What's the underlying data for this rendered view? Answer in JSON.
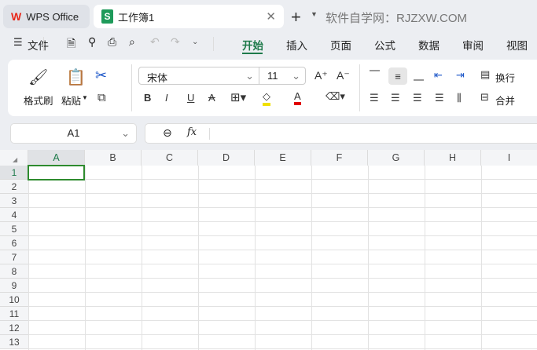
{
  "tabs": {
    "home": "WPS Office",
    "doc": "工作簿1",
    "watermark": "软件自学网：RJZXW.COM"
  },
  "menu": {
    "file": "文件",
    "items": [
      "开始",
      "插入",
      "页面",
      "公式",
      "数据",
      "审阅",
      "视图"
    ],
    "active": 0
  },
  "ribbon": {
    "format_painter": "格式刷",
    "paste": "粘贴",
    "font": "宋体",
    "size": "11",
    "wrap": "换行",
    "merge": "合并"
  },
  "formula_bar": {
    "cell_ref": "A1",
    "fx": "fx",
    "value": ""
  },
  "grid": {
    "columns": [
      "A",
      "B",
      "C",
      "D",
      "E",
      "F",
      "G",
      "H",
      "I"
    ],
    "rows": [
      "1",
      "2",
      "3",
      "4",
      "5",
      "6",
      "7",
      "8",
      "9",
      "10",
      "11",
      "12",
      "13"
    ],
    "selected": "A1"
  },
  "colors": {
    "accent": "#1e7a4a",
    "selection": "#2e8b2e"
  }
}
